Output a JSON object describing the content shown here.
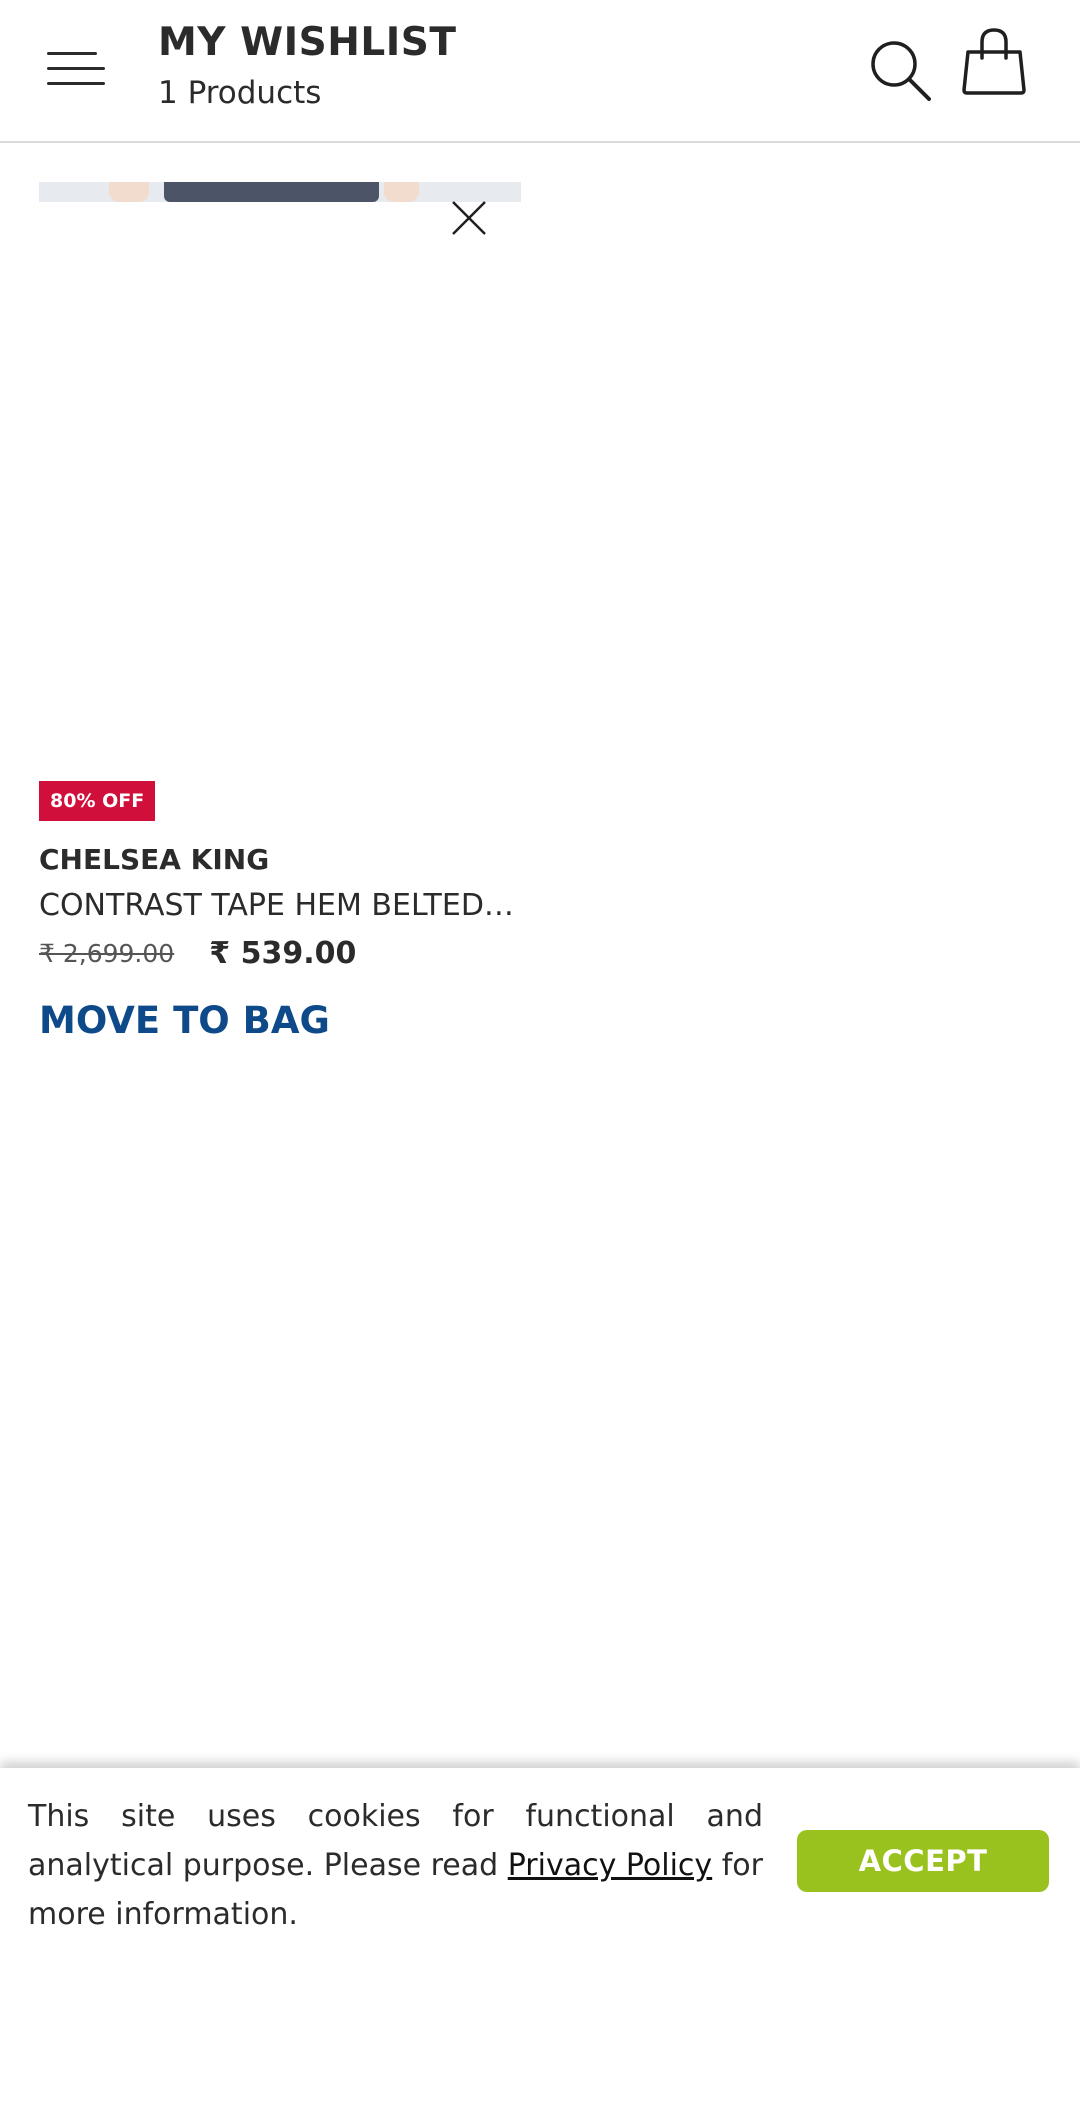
{
  "header": {
    "title": "MY WISHLIST",
    "subtitle": "1 Products",
    "icons": {
      "menu": "menu-icon",
      "search": "search-icon",
      "bag": "shopping-bag-icon"
    }
  },
  "wishlist": {
    "items": [
      {
        "discount_badge": "80% OFF",
        "brand": "CHELSEA KING",
        "name": "CONTRAST TAPE HEM BELTED SHIRT",
        "price_original": "₹ 2,699.00",
        "price_current": "₹ 539.00",
        "action_label": "MOVE TO BAG",
        "remove_icon": "close-icon"
      }
    ]
  },
  "cookie_banner": {
    "text_before": "This site uses cookies for functional and analytical purpose. Please read ",
    "link_label": "Privacy Policy",
    "text_after": " for more information.",
    "accept_label": "ACCEPT"
  },
  "colors": {
    "badge_red": "#d0103a",
    "action_blue": "#0e4a8a",
    "accept_green": "#9ac21f",
    "text_dark": "#2b2b2b"
  }
}
